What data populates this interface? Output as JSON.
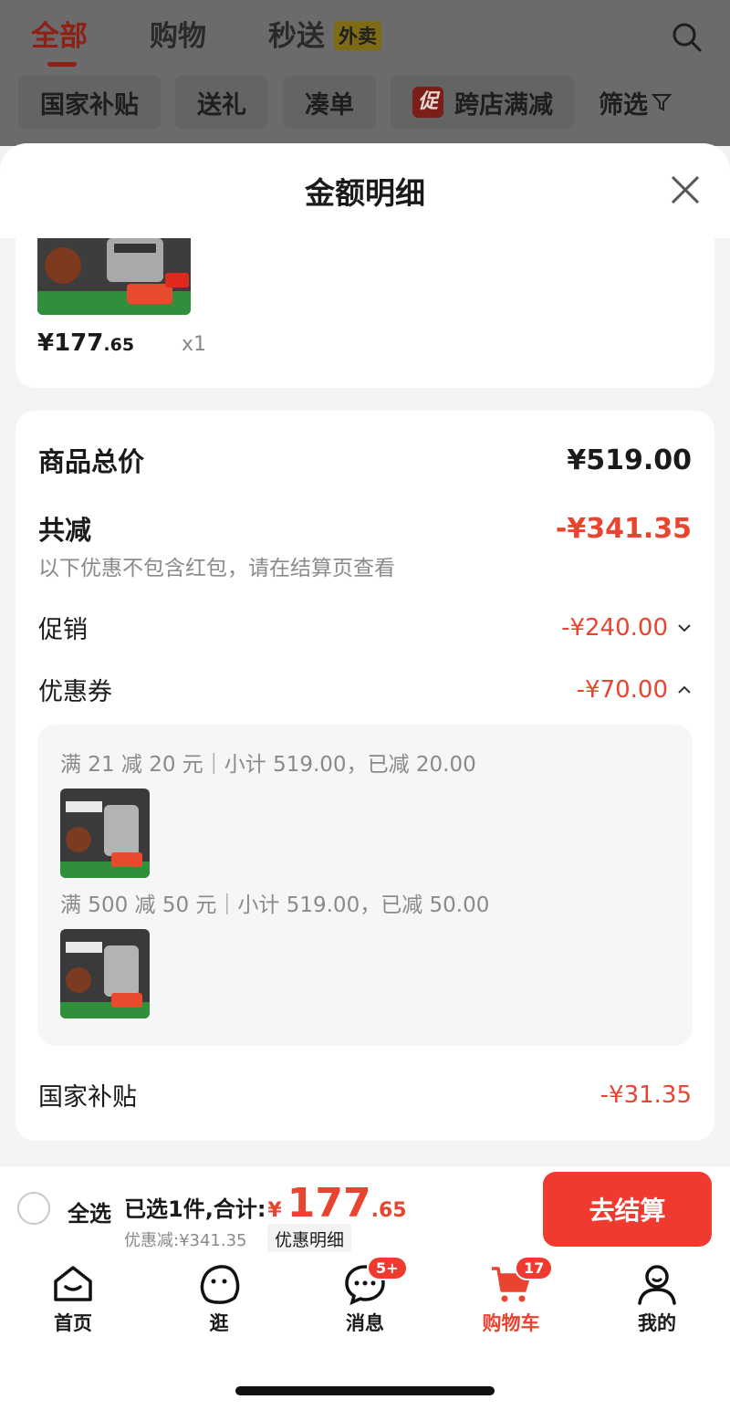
{
  "top_tabs": [
    {
      "label": "全部",
      "active": true
    },
    {
      "label": "购物",
      "active": false
    },
    {
      "label": "秒送",
      "active": false,
      "tag": "外卖"
    }
  ],
  "filters": [
    "国家补贴",
    "送礼",
    "凑单",
    "跨店满减",
    "筛选"
  ],
  "filter_promo_icon": "促",
  "sheet": {
    "title": "金额明细",
    "item": {
      "price_main": "¥177",
      "price_cents": ".65",
      "qty": "x1"
    }
  },
  "breakdown": {
    "total_label": "商品总价",
    "total_value": "¥519.00",
    "reduce_label": "共减",
    "reduce_value": "-¥341.35",
    "note": "以下优惠不包含红包，请在结算页查看",
    "promo_label": "促销",
    "promo_value": "-¥240.00",
    "coupon_label": "优惠券",
    "coupon_value": "-¥70.00",
    "coupons": [
      {
        "text": "满 21 减 20 元｜小计 519.00，已减 20.00"
      },
      {
        "text": "满 500 减 50 元｜小计 519.00，已减 50.00"
      }
    ],
    "subsidy_label": "国家补贴",
    "subsidy_value": "-¥31.35"
  },
  "checkout": {
    "select_all": "全选",
    "selected_text": "已选1件,合计:",
    "yen": "¥",
    "amount_main": "177",
    "amount_cents": ".65",
    "saved_text": "优惠减:¥341.35",
    "detail_button": "优惠明细",
    "pay_button": "去结算"
  },
  "tabbar": [
    {
      "label": "首页",
      "icon": "home-icon"
    },
    {
      "label": "逛",
      "icon": "browse-icon"
    },
    {
      "label": "消息",
      "icon": "message-icon",
      "badge": "5+"
    },
    {
      "label": "购物车",
      "icon": "cart-icon",
      "badge": "17",
      "active": true
    },
    {
      "label": "我的",
      "icon": "profile-icon"
    }
  ],
  "colors": {
    "accent": "#e8442f",
    "button": "#f03a30",
    "dim_overlay": "#6b6b6b"
  }
}
